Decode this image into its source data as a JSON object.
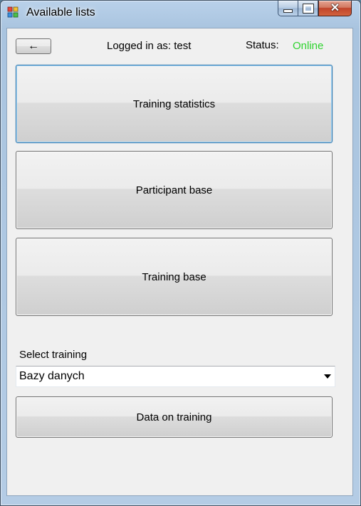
{
  "window": {
    "title": "Available lists"
  },
  "header": {
    "back_label": "←",
    "logged_in_text": "Logged in as: test",
    "status_label": "Status:",
    "status_value": "Online"
  },
  "menu": {
    "buttons": [
      {
        "label": "Training statistics"
      },
      {
        "label": "Participant base"
      },
      {
        "label": "Training base"
      }
    ]
  },
  "training": {
    "select_label": "Select training",
    "selected_value": "Bazy danych",
    "data_button_label": "Data on training"
  },
  "colors": {
    "status_online": "#2fd32f",
    "focus_border": "#3c7fb1"
  }
}
